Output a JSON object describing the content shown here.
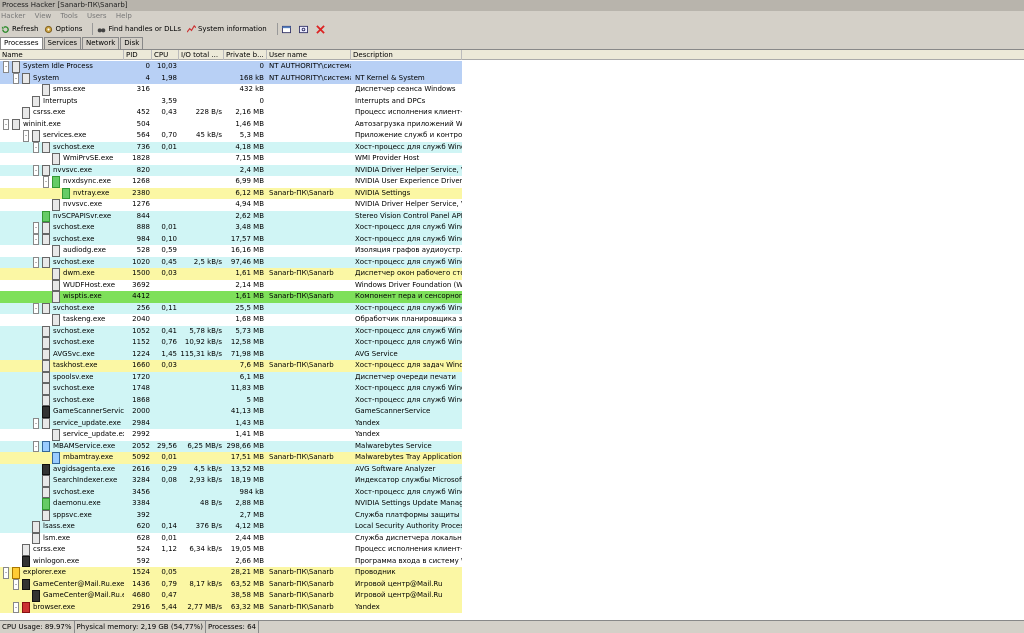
{
  "window": {
    "title": "Process Hacker [Sanarb-ПК\\Sanarb]"
  },
  "menu": [
    "Hacker",
    "View",
    "Tools",
    "Users",
    "Help"
  ],
  "toolbar": {
    "refresh": "Refresh",
    "options": "Options",
    "find": "Find handles or DLLs",
    "sysinfo": "System information"
  },
  "tabs": [
    "Processes",
    "Services",
    "Network",
    "Disk"
  ],
  "columns": [
    "Name",
    "PID",
    "CPU",
    "I/O total ...",
    "Private b...",
    "User name",
    "Description"
  ],
  "status": {
    "cpu": "CPU Usage: 89.97%",
    "mem": "Physical memory: 2,19 GB (54,77%)",
    "procs": "Processes: 64"
  },
  "rows": [
    {
      "name": "System Idle Process",
      "pid": "0",
      "cpu": "10,03",
      "io": "",
      "pb": "0",
      "user": "NT AUTHORITY\\система",
      "desc": "",
      "d": 0,
      "e": "-",
      "c": "#b8d0f5",
      "ic": "w"
    },
    {
      "name": "System",
      "pid": "4",
      "cpu": "1,98",
      "io": "",
      "pb": "168 kB",
      "user": "NT AUTHORITY\\система",
      "desc": "NT Kernel & System",
      "d": 1,
      "e": "-",
      "c": "#b8d0f5",
      "ic": "w"
    },
    {
      "name": "smss.exe",
      "pid": "316",
      "cpu": "",
      "io": "",
      "pb": "432 kB",
      "user": "",
      "desc": "Диспетчер сеанса  Windows",
      "d": 3,
      "e": "",
      "c": "",
      "ic": "w"
    },
    {
      "name": "Interrupts",
      "pid": "",
      "cpu": "3,59",
      "io": "",
      "pb": "0",
      "user": "",
      "desc": "Interrupts and DPCs",
      "d": 2,
      "e": "",
      "c": "",
      "ic": "w"
    },
    {
      "name": "csrss.exe",
      "pid": "452",
      "cpu": "0,43",
      "io": "228 B/s",
      "pb": "2,16 MB",
      "user": "",
      "desc": "Процесс исполнения клиент-с...",
      "d": 1,
      "e": "",
      "c": "",
      "ic": "w"
    },
    {
      "name": "wininit.exe",
      "pid": "504",
      "cpu": "",
      "io": "",
      "pb": "1,46 MB",
      "user": "",
      "desc": "Автозагрузка приложений Wi...",
      "d": 0,
      "e": "-",
      "c": "",
      "ic": "w"
    },
    {
      "name": "services.exe",
      "pid": "564",
      "cpu": "0,70",
      "io": "45 kB/s",
      "pb": "5,3 MB",
      "user": "",
      "desc": "Приложение служб и контрол...",
      "d": 2,
      "e": "-",
      "c": "",
      "ic": "w"
    },
    {
      "name": "svchost.exe",
      "pid": "736",
      "cpu": "0,01",
      "io": "",
      "pb": "4,18 MB",
      "user": "",
      "desc": "Хост-процесс для служб Windo...",
      "d": 3,
      "e": "-",
      "c": "#d0f5f5",
      "ic": "w"
    },
    {
      "name": "WmiPrvSE.exe",
      "pid": "1828",
      "cpu": "",
      "io": "",
      "pb": "7,15 MB",
      "user": "",
      "desc": "WMI Provider Host",
      "d": 4,
      "e": "",
      "c": "",
      "ic": "w"
    },
    {
      "name": "nvvsvc.exe",
      "pid": "820",
      "cpu": "",
      "io": "",
      "pb": "2,4 MB",
      "user": "",
      "desc": "NVIDIA Driver Helper Service, V...",
      "d": 3,
      "e": "-",
      "c": "#d0f5f5",
      "ic": "w"
    },
    {
      "name": "nvxdsync.exe",
      "pid": "1268",
      "cpu": "",
      "io": "",
      "pb": "6,99 MB",
      "user": "",
      "desc": "NVIDIA User Experience Driver ...",
      "d": 4,
      "e": "-",
      "c": "",
      "ic": "g"
    },
    {
      "name": "nvtray.exe",
      "pid": "2380",
      "cpu": "",
      "io": "",
      "pb": "6,12 MB",
      "user": "Sanarb-ПК\\Sanarb",
      "desc": "NVIDIA Settings",
      "d": 5,
      "e": "",
      "c": "#fbf7a4",
      "ic": "g"
    },
    {
      "name": "nvvsvc.exe",
      "pid": "1276",
      "cpu": "",
      "io": "",
      "pb": "4,94 MB",
      "user": "",
      "desc": "NVIDIA Driver Helper Service, V...",
      "d": 4,
      "e": "",
      "c": "",
      "ic": "w"
    },
    {
      "name": "nvSCPAPISvr.exe",
      "pid": "844",
      "cpu": "",
      "io": "",
      "pb": "2,62 MB",
      "user": "",
      "desc": "Stereo Vision Control Panel API ...",
      "d": 3,
      "e": "",
      "c": "#d0f5f5",
      "ic": "g"
    },
    {
      "name": "svchost.exe",
      "pid": "888",
      "cpu": "0,01",
      "io": "",
      "pb": "3,48 MB",
      "user": "",
      "desc": "Хост-процесс для служб Windo...",
      "d": 3,
      "e": "-",
      "c": "#d0f5f5",
      "ic": "w"
    },
    {
      "name": "svchost.exe",
      "pid": "984",
      "cpu": "0,10",
      "io": "",
      "pb": "17,57 MB",
      "user": "",
      "desc": "Хост-процесс для служб Windo...",
      "d": 3,
      "e": "-",
      "c": "#d0f5f5",
      "ic": "w"
    },
    {
      "name": "audiodg.exe",
      "pid": "528",
      "cpu": "0,59",
      "io": "",
      "pb": "16,16 MB",
      "user": "",
      "desc": "Изоляция графов аудиоустр...",
      "d": 4,
      "e": "",
      "c": "",
      "ic": "w"
    },
    {
      "name": "svchost.exe",
      "pid": "1020",
      "cpu": "0,45",
      "io": "2,5 kB/s",
      "pb": "97,46 MB",
      "user": "",
      "desc": "Хост-процесс для служб Windo...",
      "d": 3,
      "e": "-",
      "c": "#d0f5f5",
      "ic": "w"
    },
    {
      "name": "dwm.exe",
      "pid": "1500",
      "cpu": "0,03",
      "io": "",
      "pb": "1,61 MB",
      "user": "Sanarb-ПК\\Sanarb",
      "desc": "Диспетчер окон рабочего стола",
      "d": 4,
      "e": "",
      "c": "#fbf7a4",
      "ic": "w"
    },
    {
      "name": "WUDFHost.exe",
      "pid": "3692",
      "cpu": "",
      "io": "",
      "pb": "2,14 MB",
      "user": "",
      "desc": "Windows Driver Foundation (WD...",
      "d": 4,
      "e": "",
      "c": "",
      "ic": "w"
    },
    {
      "name": "wisptis.exe",
      "pid": "4412",
      "cpu": "",
      "io": "",
      "pb": "1,61 MB",
      "user": "Sanarb-ПК\\Sanarb",
      "desc": "Компонент пера и сенсорного ...",
      "d": 4,
      "e": "",
      "c": "#7ee05a",
      "ic": "w"
    },
    {
      "name": "svchost.exe",
      "pid": "256",
      "cpu": "0,11",
      "io": "",
      "pb": "25,5 MB",
      "user": "",
      "desc": "Хост-процесс для служб Windo...",
      "d": 3,
      "e": "-",
      "c": "#d0f5f5",
      "ic": "w"
    },
    {
      "name": "taskeng.exe",
      "pid": "2040",
      "cpu": "",
      "io": "",
      "pb": "1,68 MB",
      "user": "",
      "desc": "Обработчик планировщика за...",
      "d": 4,
      "e": "",
      "c": "",
      "ic": "w"
    },
    {
      "name": "svchost.exe",
      "pid": "1052",
      "cpu": "0,41",
      "io": "5,78 kB/s",
      "pb": "5,73 MB",
      "user": "",
      "desc": "Хост-процесс для служб Windo...",
      "d": 3,
      "e": "",
      "c": "#d0f5f5",
      "ic": "w"
    },
    {
      "name": "svchost.exe",
      "pid": "1152",
      "cpu": "0,76",
      "io": "10,92 kB/s",
      "pb": "12,58 MB",
      "user": "",
      "desc": "Хост-процесс для служб Windo...",
      "d": 3,
      "e": "",
      "c": "#d0f5f5",
      "ic": "w"
    },
    {
      "name": "AVGSvc.exe",
      "pid": "1224",
      "cpu": "1,45",
      "io": "115,31 kB/s",
      "pb": "71,98 MB",
      "user": "",
      "desc": "AVG Service",
      "d": 3,
      "e": "",
      "c": "#d0f5f5",
      "ic": "w"
    },
    {
      "name": "taskhost.exe",
      "pid": "1660",
      "cpu": "0,03",
      "io": "",
      "pb": "7,6 MB",
      "user": "Sanarb-ПК\\Sanarb",
      "desc": "Хост-процесс для задач Windows",
      "d": 3,
      "e": "",
      "c": "#fbf7a4",
      "ic": "w"
    },
    {
      "name": "spoolsv.exe",
      "pid": "1720",
      "cpu": "",
      "io": "",
      "pb": "6,1 MB",
      "user": "",
      "desc": "Диспетчер очереди печати",
      "d": 3,
      "e": "",
      "c": "#d0f5f5",
      "ic": "w"
    },
    {
      "name": "svchost.exe",
      "pid": "1748",
      "cpu": "",
      "io": "",
      "pb": "11,83 MB",
      "user": "",
      "desc": "Хост-процесс для служб Windo...",
      "d": 3,
      "e": "",
      "c": "#d0f5f5",
      "ic": "w"
    },
    {
      "name": "svchost.exe",
      "pid": "1868",
      "cpu": "",
      "io": "",
      "pb": "5 MB",
      "user": "",
      "desc": "Хост-процесс для служб Windo...",
      "d": 3,
      "e": "",
      "c": "#d0f5f5",
      "ic": "w"
    },
    {
      "name": "GameScannerService....",
      "pid": "2000",
      "cpu": "",
      "io": "",
      "pb": "41,13 MB",
      "user": "",
      "desc": "GameScannerService",
      "d": 3,
      "e": "",
      "c": "#d0f5f5",
      "ic": "k"
    },
    {
      "name": "service_update.exe",
      "pid": "2984",
      "cpu": "",
      "io": "",
      "pb": "1,43 MB",
      "user": "",
      "desc": "Yandex",
      "d": 3,
      "e": "-",
      "c": "#d0f5f5",
      "ic": "w"
    },
    {
      "name": "service_update.exe",
      "pid": "2992",
      "cpu": "",
      "io": "",
      "pb": "1,41 MB",
      "user": "",
      "desc": "Yandex",
      "d": 4,
      "e": "",
      "c": "",
      "ic": "w"
    },
    {
      "name": "MBAMService.exe",
      "pid": "2052",
      "cpu": "29,56",
      "io": "6,25 MB/s",
      "pb": "298,66 MB",
      "user": "",
      "desc": "Malwarebytes Service",
      "d": 3,
      "e": "-",
      "c": "#d0f5f5",
      "ic": "b"
    },
    {
      "name": "mbamtray.exe",
      "pid": "5092",
      "cpu": "0,01",
      "io": "",
      "pb": "17,51 MB",
      "user": "Sanarb-ПК\\Sanarb",
      "desc": "Malwarebytes Tray Application",
      "d": 4,
      "e": "",
      "c": "#fbf7a4",
      "ic": "b"
    },
    {
      "name": "avgidsagenta.exe",
      "pid": "2616",
      "cpu": "0,29",
      "io": "4,5 kB/s",
      "pb": "13,52 MB",
      "user": "",
      "desc": "AVG Software Analyzer",
      "d": 3,
      "e": "",
      "c": "#d0f5f5",
      "ic": "k"
    },
    {
      "name": "SearchIndexer.exe",
      "pid": "3284",
      "cpu": "0,08",
      "io": "2,93 kB/s",
      "pb": "18,19 MB",
      "user": "",
      "desc": "Индексатор службы Microsoft ...",
      "d": 3,
      "e": "",
      "c": "#d0f5f5",
      "ic": "w"
    },
    {
      "name": "svchost.exe",
      "pid": "3456",
      "cpu": "",
      "io": "",
      "pb": "984 kB",
      "user": "",
      "desc": "Хост-процесс для служб Windo...",
      "d": 3,
      "e": "",
      "c": "#d0f5f5",
      "ic": "w"
    },
    {
      "name": "daemonu.exe",
      "pid": "3384",
      "cpu": "",
      "io": "48 B/s",
      "pb": "2,88 MB",
      "user": "",
      "desc": "NVIDIA Settings Update Manager",
      "d": 3,
      "e": "",
      "c": "#d0f5f5",
      "ic": "g"
    },
    {
      "name": "sppsvc.exe",
      "pid": "392",
      "cpu": "",
      "io": "",
      "pb": "2,7 MB",
      "user": "",
      "desc": "Служба платформы защиты п...",
      "d": 3,
      "e": "",
      "c": "#d0f5f5",
      "ic": "w"
    },
    {
      "name": "lsass.exe",
      "pid": "620",
      "cpu": "0,14",
      "io": "376 B/s",
      "pb": "4,12 MB",
      "user": "",
      "desc": "Local Security Authority Process",
      "d": 2,
      "e": "",
      "c": "#d0f5f5",
      "ic": "w"
    },
    {
      "name": "lsm.exe",
      "pid": "628",
      "cpu": "0,01",
      "io": "",
      "pb": "2,44 MB",
      "user": "",
      "desc": "Служба диспетчера локальны...",
      "d": 2,
      "e": "",
      "c": "",
      "ic": "w"
    },
    {
      "name": "csrss.exe",
      "pid": "524",
      "cpu": "1,12",
      "io": "6,34 kB/s",
      "pb": "19,05 MB",
      "user": "",
      "desc": "Процесс исполнения клиент-с...",
      "d": 1,
      "e": "",
      "c": "",
      "ic": "w"
    },
    {
      "name": "winlogon.exe",
      "pid": "592",
      "cpu": "",
      "io": "",
      "pb": "2,66 MB",
      "user": "",
      "desc": "Программа входа в систему Wi...",
      "d": 1,
      "e": "",
      "c": "",
      "ic": "k"
    },
    {
      "name": "explorer.exe",
      "pid": "1524",
      "cpu": "0,05",
      "io": "",
      "pb": "28,21 MB",
      "user": "Sanarb-ПК\\Sanarb",
      "desc": "Проводник",
      "d": 0,
      "e": "-",
      "c": "#fbf7a4",
      "ic": "y"
    },
    {
      "name": "GameCenter@Mail.Ru.exe",
      "pid": "1436",
      "cpu": "0,79",
      "io": "8,17 kB/s",
      "pb": "63,52 MB",
      "user": "Sanarb-ПК\\Sanarb",
      "desc": "Игровой центр@Mail.Ru",
      "d": 1,
      "e": "-",
      "c": "#fbf7a4",
      "ic": "k"
    },
    {
      "name": "GameCenter@Mail.Ru.exe",
      "pid": "4680",
      "cpu": "0,47",
      "io": "",
      "pb": "38,58 MB",
      "user": "Sanarb-ПК\\Sanarb",
      "desc": "Игровой центр@Mail.Ru",
      "d": 2,
      "e": "",
      "c": "#fbf7a4",
      "ic": "k"
    },
    {
      "name": "browser.exe",
      "pid": "2916",
      "cpu": "5,44",
      "io": "2,77 MB/s",
      "pb": "63,32 MB",
      "user": "Sanarb-ПК\\Sanarb",
      "desc": "Yandex",
      "d": 1,
      "e": "-",
      "c": "#fbf7a4",
      "ic": "r"
    }
  ]
}
